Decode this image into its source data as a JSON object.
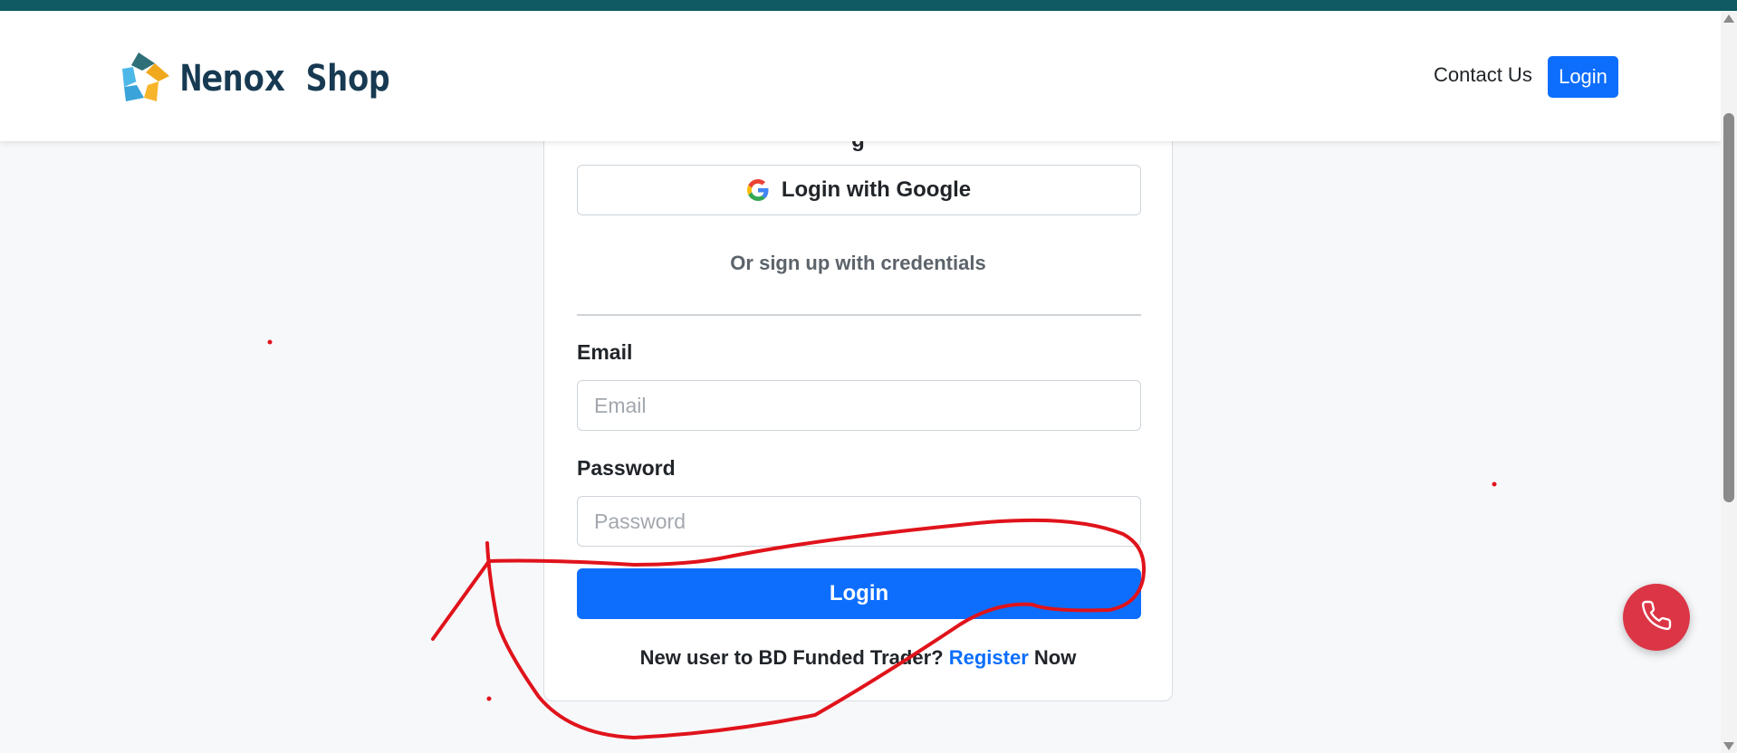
{
  "colors": {
    "topbar": "#0f5a63",
    "primary": "#0d6efd",
    "call_button": "#dc3545",
    "annotation": "#e0131b",
    "logo_text": "#173a52"
  },
  "header": {
    "brand_name": "Nenox Shop",
    "logo_icon": "brand-logo-icon",
    "nav": {
      "contact_label": "Contact Us",
      "login_label": "Login"
    }
  },
  "login_card": {
    "google_button_label": "Login with Google",
    "google_icon": "google-icon",
    "divider_text": "Or sign up with credentials",
    "email": {
      "label": "Email",
      "placeholder": "Email",
      "value": ""
    },
    "password": {
      "label": "Password",
      "placeholder": "Password",
      "value": ""
    },
    "submit_label": "Login",
    "register": {
      "prefix": "New user to BD Funded Trader?",
      "link_text": "Register",
      "suffix": "Now"
    }
  },
  "floating": {
    "call_icon": "phone-icon"
  }
}
